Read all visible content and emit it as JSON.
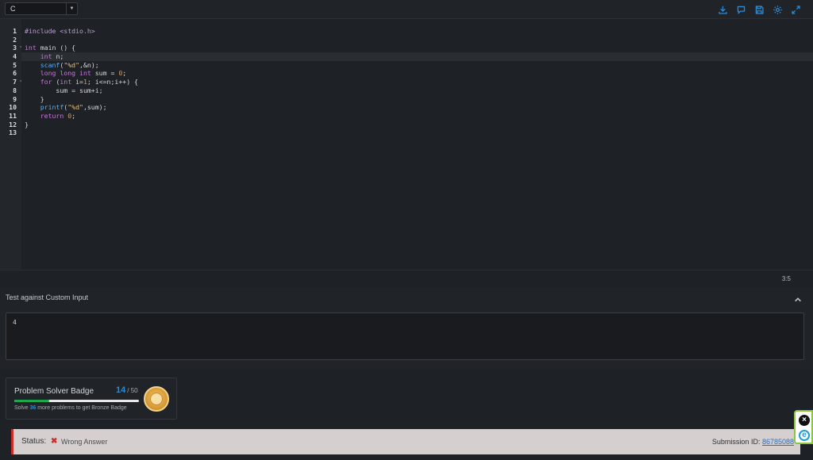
{
  "toolbar": {
    "language": "C",
    "icons": [
      "download-icon",
      "comment-icon",
      "save-icon",
      "gear-icon",
      "fullscreen-icon"
    ]
  },
  "editor": {
    "lines": [
      {
        "n": "1",
        "fold": ""
      },
      {
        "n": "2",
        "fold": ""
      },
      {
        "n": "3",
        "fold": "▾"
      },
      {
        "n": "4",
        "fold": ""
      },
      {
        "n": "5",
        "fold": ""
      },
      {
        "n": "6",
        "fold": ""
      },
      {
        "n": "7",
        "fold": "▾"
      },
      {
        "n": "8",
        "fold": ""
      },
      {
        "n": "9",
        "fold": ""
      },
      {
        "n": "10",
        "fold": ""
      },
      {
        "n": "11",
        "fold": ""
      },
      {
        "n": "12",
        "fold": ""
      },
      {
        "n": "13",
        "fold": ""
      }
    ],
    "code": {
      "l1": "#include <stdio.h>",
      "l3a": "int",
      "l3b": " main () {",
      "l4a": "    int",
      "l4b": " n;",
      "l5a": "    ",
      "l5b": "scanf",
      "l5c": "(",
      "l5d": "\"%d\"",
      "l5e": ",&n);",
      "l6a": "    long",
      "l6b": " ",
      "l6c": "long",
      "l6d": " ",
      "l6e": "int",
      "l6f": " sum = ",
      "l6g": "0",
      "l6h": ";",
      "l7a": "    for",
      "l7b": " (",
      "l7c": "int",
      "l7d": " i=",
      "l7e": "1",
      "l7f": "; i<=n;i++) {",
      "l8": "        sum = sum+i;",
      "l9": "    }",
      "l10a": "    ",
      "l10b": "printf",
      "l10c": "(",
      "l10d": "\"%d\"",
      "l10e": ",sum);",
      "l11a": "    return",
      "l11b": " ",
      "l11c": "0",
      "l11d": ";",
      "l12": "}"
    },
    "cursor_position": "3:5"
  },
  "custom_input": {
    "label": "Test against Custom Input",
    "value": "4"
  },
  "badge": {
    "title": "Problem Solver Badge",
    "count": "14",
    "total": "/ 50",
    "progress_fraction": 0.28,
    "hint_prefix": "Solve ",
    "hint_number": "36",
    "hint_suffix": " more problems to get Bronze Badge"
  },
  "status": {
    "label": "Status:",
    "value": "Wrong Answer",
    "submission_label": "Submission ID: ",
    "submission_id": "86785088",
    "color": "#c9302c"
  }
}
